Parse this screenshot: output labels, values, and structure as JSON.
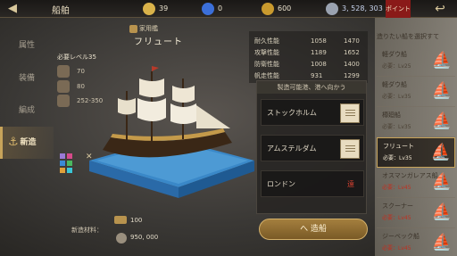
{
  "topbar": {
    "title": "船舶",
    "resources": [
      {
        "icon": "medal-icon",
        "value": "39"
      },
      {
        "icon": "gem-icon",
        "value": "0"
      },
      {
        "icon": "coin-icon",
        "value": "600"
      },
      {
        "icon": "silver-icon",
        "value": "3, 528, 303"
      }
    ],
    "points_tab": "ポイント"
  },
  "menu": {
    "attributes": "属性",
    "equipment": "装備",
    "formation": "編成",
    "build": "新造"
  },
  "ship": {
    "category": "家用艦",
    "name": "フリュート",
    "required_level": "必要レベル35",
    "stats": [
      {
        "value": "70"
      },
      {
        "value": "80"
      },
      {
        "value": "252-350"
      }
    ],
    "colors": [
      "#9a7ad6",
      "#d64a8a",
      "#3a8ad6",
      "#4ab860",
      "#e0a03a",
      "#3ac6d6"
    ]
  },
  "stats_panel": [
    {
      "label": "耐久性能",
      "min": "1058",
      "max": "1470"
    },
    {
      "label": "攻撃性能",
      "min": "1189",
      "max": "1652"
    },
    {
      "label": "防衛性能",
      "min": "1008",
      "max": "1400"
    },
    {
      "label": "帆走性能",
      "min": "931",
      "max": "1299"
    }
  ],
  "port_select": {
    "header": "製造可能港、港へ向かう",
    "ports": [
      {
        "name": "ストックホルム"
      },
      {
        "name": "アムステルダム"
      },
      {
        "name": "ロンドン",
        "mark": "遠"
      }
    ]
  },
  "cost": {
    "label": "新造材料：",
    "material": "100",
    "silver": "950, 000"
  },
  "build_button": "へ 造船",
  "ship_list": {
    "header": "造りたい船を選択すて",
    "items": [
      {
        "name": "軽ダウ船",
        "level": "必要：Lv25",
        "locked": false,
        "selected": false
      },
      {
        "name": "軽ダウ船",
        "level": "必要：Lv35",
        "locked": false,
        "selected": false
      },
      {
        "name": "樽廻船",
        "level": "必要：Lv35",
        "locked": false,
        "selected": false
      },
      {
        "name": "フリュート",
        "level": "必要：Lv35",
        "locked": false,
        "selected": true
      },
      {
        "name": "オスマンガレアス船",
        "level": "必要：Lv45",
        "locked": true,
        "selected": false
      },
      {
        "name": "スクーナー",
        "level": "必要：Lv45",
        "locked": true,
        "selected": false
      },
      {
        "name": "ジーベック船",
        "level": "必要：Lv45",
        "locked": true,
        "selected": false
      }
    ]
  }
}
